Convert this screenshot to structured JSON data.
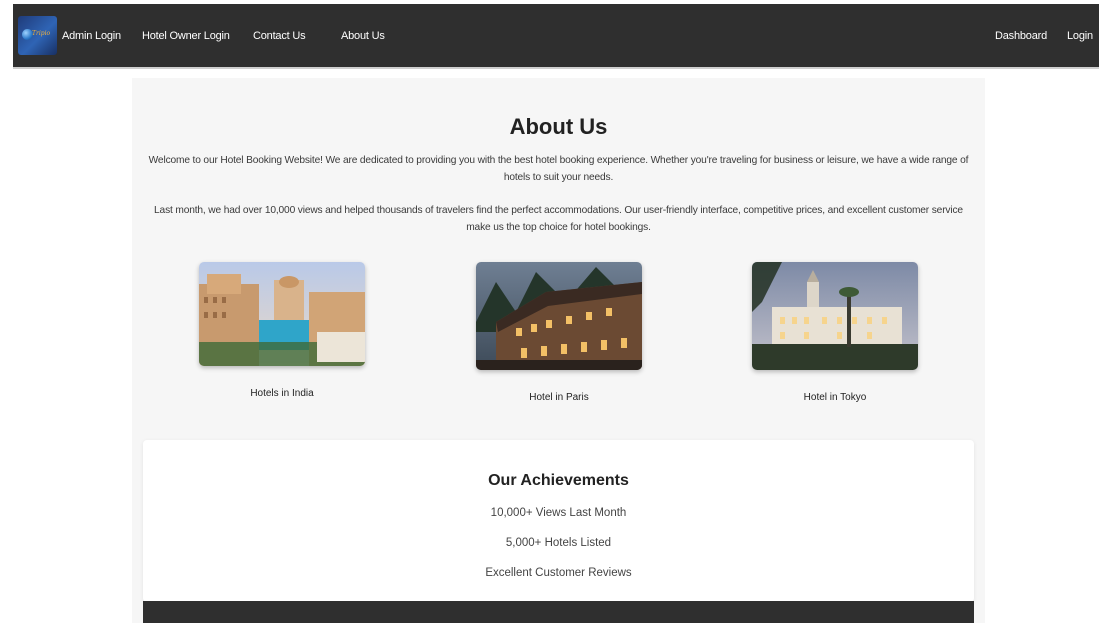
{
  "navbar": {
    "logo_text": "Tripio",
    "left_links": [
      "Admin Login",
      "Hotel Owner Login",
      "Contact Us",
      "About Us"
    ],
    "right_links": [
      "Dashboard",
      "Login"
    ]
  },
  "about": {
    "title": "About Us",
    "para1": "Welcome to our Hotel Booking Website! We are dedicated to providing you with the best hotel booking experience. Whether you're traveling for business or leisure, we have a wide range of hotels to suit your needs.",
    "para2": "Last month, we had over 10,000 views and helped thousands of travelers find the perfect accommodations. Our user-friendly interface, competitive prices, and excellent customer service make us the top choice for hotel bookings."
  },
  "cards": [
    {
      "caption": "Hotels in India"
    },
    {
      "caption": "Hotel in Paris"
    },
    {
      "caption": "Hotel in Tokyo"
    }
  ],
  "achievements": {
    "title": "Our Achievements",
    "items": [
      "10,000+ Views Last Month",
      "5,000+ Hotels Listed",
      "Excellent Customer Reviews"
    ]
  },
  "colors": {
    "navbar_bg": "#2f2f2f",
    "panel_bg": "#f6f6f6",
    "text": "#222222"
  }
}
